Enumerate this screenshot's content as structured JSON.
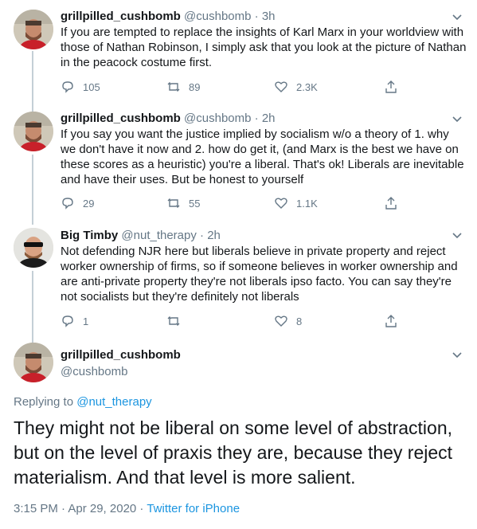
{
  "tweets": [
    {
      "name": "grillpilled_cushbomb",
      "handle": "@cushbomb",
      "time": "3h",
      "text": "If you are tempted to replace the insights of Karl Marx in your worldview with those of Nathan Robinson, I simply ask that you look at the picture of Nathan in the peacock costume first.",
      "replies": "105",
      "retweets": "89",
      "likes": "2.3K"
    },
    {
      "name": "grillpilled_cushbomb",
      "handle": "@cushbomb",
      "time": "2h",
      "text": "If you say you want the justice implied by socialism w/o a theory of 1. why we don't have it now and 2. how do get it, (and Marx is the best we have on these scores as a heuristic) you're a liberal. That's ok! Liberals are inevitable and have their uses. But be honest to yourself",
      "replies": "29",
      "retweets": "55",
      "likes": "1.1K"
    },
    {
      "name": "Big Timby",
      "handle": "@nut_therapy",
      "time": "2h",
      "text": "Not defending NJR here but liberals believe in private property and reject worker ownership of firms, so if someone believes in worker ownership and are anti-private property they're not liberals ipso facto. You can say they're not socialists but they're definitely not liberals",
      "replies": "1",
      "retweets": "",
      "likes": "8"
    }
  ],
  "main": {
    "name": "grillpilled_cushbomb",
    "handle": "@cushbomb",
    "replying_label": "Replying to",
    "replying_to": "@nut_therapy",
    "text": "They might not be liberal on some level of abstraction, but on the level of praxis they are, because they reject materialism. And that level is more salient.",
    "timestamp": "3:15 PM · Apr 29, 2020 · ",
    "source": "Twitter for iPhone"
  },
  "separator": " · ",
  "colors": {
    "accent": "#1b95e0",
    "muted": "#657786",
    "thread_line": "#c4cfd6"
  }
}
